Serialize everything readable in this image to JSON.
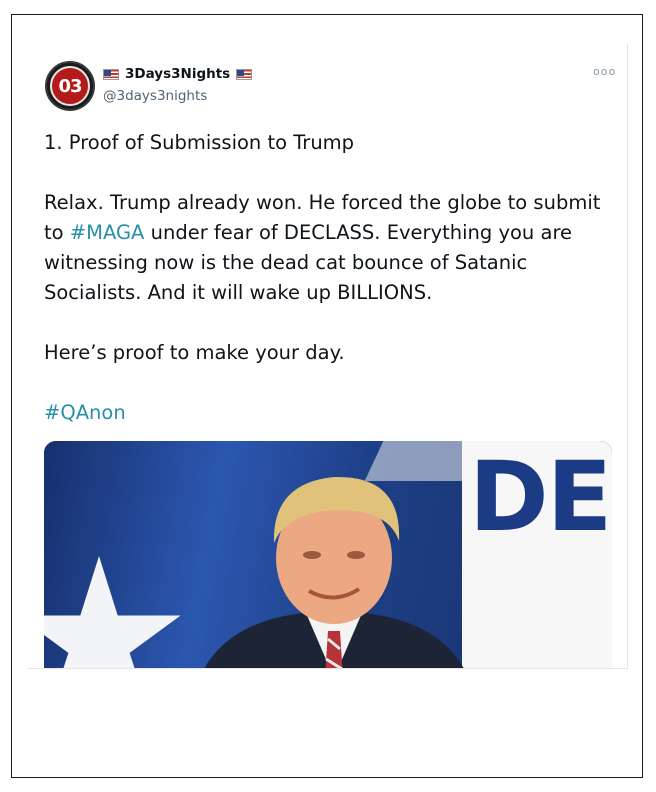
{
  "tweet": {
    "avatar_text": "03",
    "display_name": "3Days3Nights",
    "handle": "@3days3nights",
    "more_label": "ooo",
    "paragraphs": [
      "1. Proof of Submission to Trump",
      "Relax. Trump already won. He forced the globe to submit to ",
      " under fear of DECLASS. Everything you are witnessing now is the dead cat bounce of Satanic Socialists. And it will wake up BILLIONS.",
      "Here’s proof to make your day."
    ],
    "hashtag_maga": "#MAGA",
    "hashtag_qanon": "#QAnon",
    "media_text": "DEC"
  },
  "colors": {
    "hashtag": "#2a8fa8",
    "flag_red": "#c0392b",
    "flag_blue": "#2c4a8a",
    "media_text": "#1b3b84"
  },
  "icons": {
    "flag": "us-flag-icon",
    "more": "more-options-icon"
  }
}
